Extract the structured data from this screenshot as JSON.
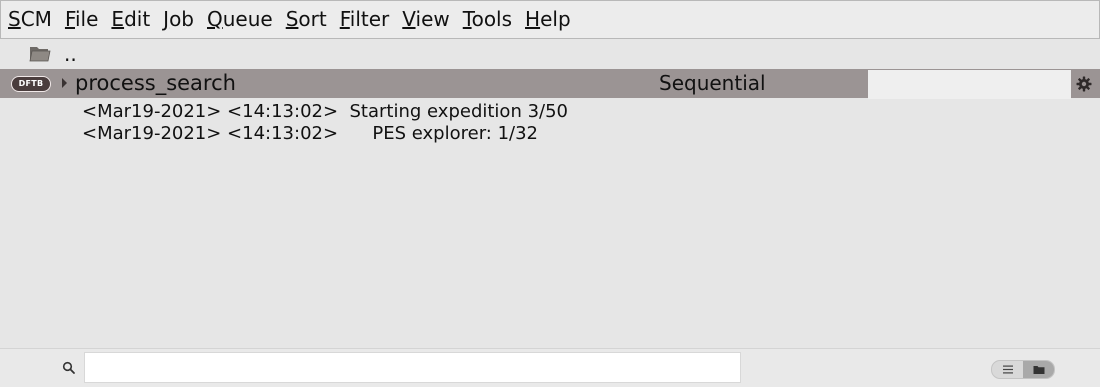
{
  "menubar": {
    "items": [
      {
        "key": "S",
        "rest": "CM"
      },
      {
        "key": "F",
        "rest": "ile"
      },
      {
        "key": "E",
        "rest": "dit"
      },
      {
        "key": "J",
        "rest": "ob"
      },
      {
        "key": "Q",
        "rest": "ueue"
      },
      {
        "key": "S",
        "rest": "ort"
      },
      {
        "key": "F",
        "rest": "ilter"
      },
      {
        "key": "V",
        "rest": "iew"
      },
      {
        "key": "T",
        "rest": "ools"
      },
      {
        "key": "H",
        "rest": "elp"
      }
    ]
  },
  "parent": {
    "label": "..",
    "icon": "folder-icon"
  },
  "job": {
    "engine": "DFTB",
    "name": "process_search",
    "mode": "Sequential",
    "field_value": "",
    "row_color": "#9b9494"
  },
  "log": {
    "lines": [
      "<Mar19-2021> <14:13:02>  Starting expedition 3/50",
      "<Mar19-2021> <14:13:02>      PES explorer: 1/32"
    ]
  },
  "bottombar": {
    "search_value": "",
    "search_icon": "magnifier-icon",
    "view_toggle": {
      "options": [
        "list-view-icon",
        "folder-view-icon"
      ],
      "active": "folder-view-icon"
    }
  }
}
